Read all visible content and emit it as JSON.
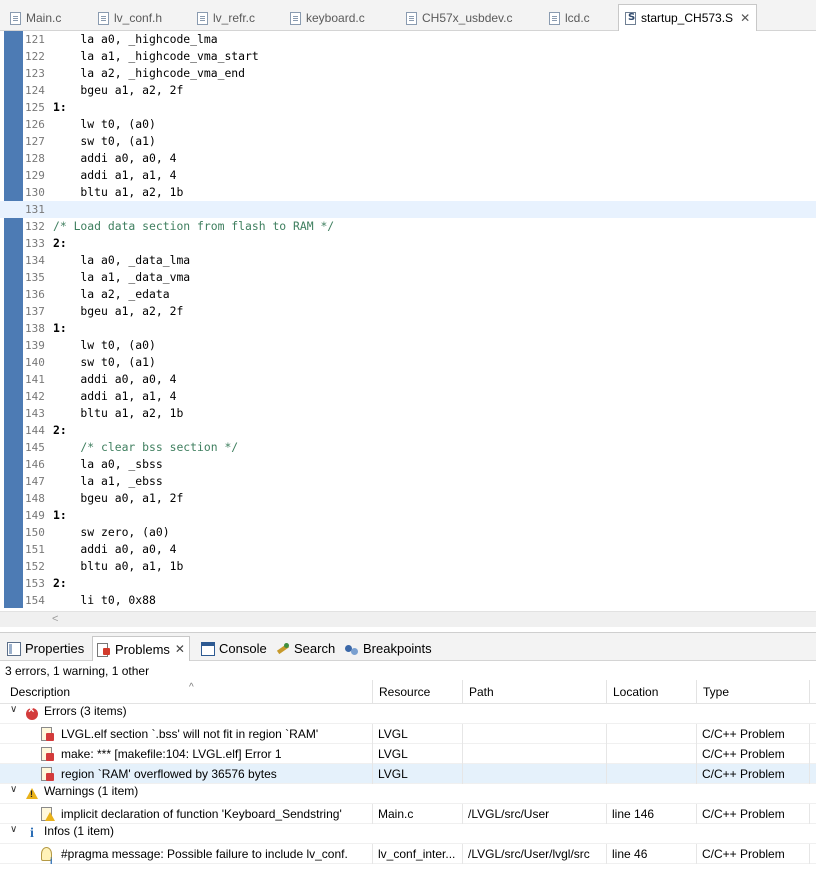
{
  "editor_tabs": [
    {
      "label": "Main.c"
    },
    {
      "label": "lv_conf.h"
    },
    {
      "label": "lv_refr.c"
    },
    {
      "label": "keyboard.c"
    },
    {
      "label": "CH57x_usbdev.c"
    },
    {
      "label": "lcd.c"
    },
    {
      "label": "startup_CH573.S",
      "active": true
    }
  ],
  "code_lines": [
    {
      "n": "121",
      "text": "    la a0, _highcode_lma"
    },
    {
      "n": "122",
      "text": "    la a1, _highcode_vma_start"
    },
    {
      "n": "123",
      "text": "    la a2, _highcode_vma_end"
    },
    {
      "n": "124",
      "text": "    bgeu a1, a2, 2f"
    },
    {
      "n": "125",
      "text": "1:"
    },
    {
      "n": "126",
      "text": "    lw t0, (a0)"
    },
    {
      "n": "127",
      "text": "    sw t0, (a1)"
    },
    {
      "n": "128",
      "text": "    addi a0, a0, 4"
    },
    {
      "n": "129",
      "text": "    addi a1, a1, 4"
    },
    {
      "n": "130",
      "text": "    bltu a1, a2, 1b"
    },
    {
      "n": "131",
      "text": ""
    },
    {
      "n": "132",
      "text": "/* Load data section from flash to RAM */"
    },
    {
      "n": "133",
      "text": "2:"
    },
    {
      "n": "134",
      "text": "    la a0, _data_lma"
    },
    {
      "n": "135",
      "text": "    la a1, _data_vma"
    },
    {
      "n": "136",
      "text": "    la a2, _edata"
    },
    {
      "n": "137",
      "text": "    bgeu a1, a2, 2f"
    },
    {
      "n": "138",
      "text": "1:"
    },
    {
      "n": "139",
      "text": "    lw t0, (a0)"
    },
    {
      "n": "140",
      "text": "    sw t0, (a1)"
    },
    {
      "n": "141",
      "text": "    addi a0, a0, 4"
    },
    {
      "n": "142",
      "text": "    addi a1, a1, 4"
    },
    {
      "n": "143",
      "text": "    bltu a1, a2, 1b"
    },
    {
      "n": "144",
      "text": "2:"
    },
    {
      "n": "145",
      "text": "    /* clear bss section */"
    },
    {
      "n": "146",
      "text": "    la a0, _sbss"
    },
    {
      "n": "147",
      "text": "    la a1, _ebss"
    },
    {
      "n": "148",
      "text": "    bgeu a0, a1, 2f"
    },
    {
      "n": "149",
      "text": "1:"
    },
    {
      "n": "150",
      "text": "    sw zero, (a0)"
    },
    {
      "n": "151",
      "text": "    addi a0, a0, 4"
    },
    {
      "n": "152",
      "text": "    bltu a0, a1, 1b"
    },
    {
      "n": "153",
      "text": "2:"
    },
    {
      "n": "154",
      "text": "    li t0, 0x88"
    }
  ],
  "view_tabs": [
    {
      "label": "Properties",
      "icon": "properties-icon"
    },
    {
      "label": "Problems",
      "icon": "problems-icon",
      "active": true
    },
    {
      "label": "Console",
      "icon": "console-icon"
    },
    {
      "label": "Search",
      "icon": "search-icon"
    },
    {
      "label": "Breakpoints",
      "icon": "breakpoints-icon"
    }
  ],
  "problems": {
    "summary": "3 errors, 1 warning, 1 other",
    "columns": [
      "Description",
      "Resource",
      "Path",
      "Location",
      "Type"
    ],
    "groups": [
      {
        "label": "Errors (3 items)",
        "kind": "error",
        "items": [
          {
            "description": "LVGL.elf section `.bss' will not fit in region `RAM'",
            "resource": "LVGL",
            "path": "",
            "location": "",
            "type": "C/C++ Problem"
          },
          {
            "description": "make: *** [makefile:104: LVGL.elf] Error 1",
            "resource": "LVGL",
            "path": "",
            "location": "",
            "type": "C/C++ Problem"
          },
          {
            "description": "region `RAM' overflowed by 36576 bytes",
            "resource": "LVGL",
            "path": "",
            "location": "",
            "type": "C/C++ Problem",
            "selected": true
          }
        ]
      },
      {
        "label": "Warnings (1 item)",
        "kind": "warning",
        "items": [
          {
            "description": "implicit declaration of function 'Keyboard_Sendstring'",
            "resource": "Main.c",
            "path": "/LVGL/src/User",
            "location": "line 146",
            "type": "C/C++ Problem"
          }
        ]
      },
      {
        "label": "Infos (1 item)",
        "kind": "info",
        "items": [
          {
            "description": "#pragma message: Possible failure to include lv_conf.",
            "resource": "lv_conf_inter...",
            "path": "/LVGL/src/User/lvgl/src",
            "location": "line 46",
            "type": "C/C++ Problem"
          }
        ]
      }
    ]
  }
}
